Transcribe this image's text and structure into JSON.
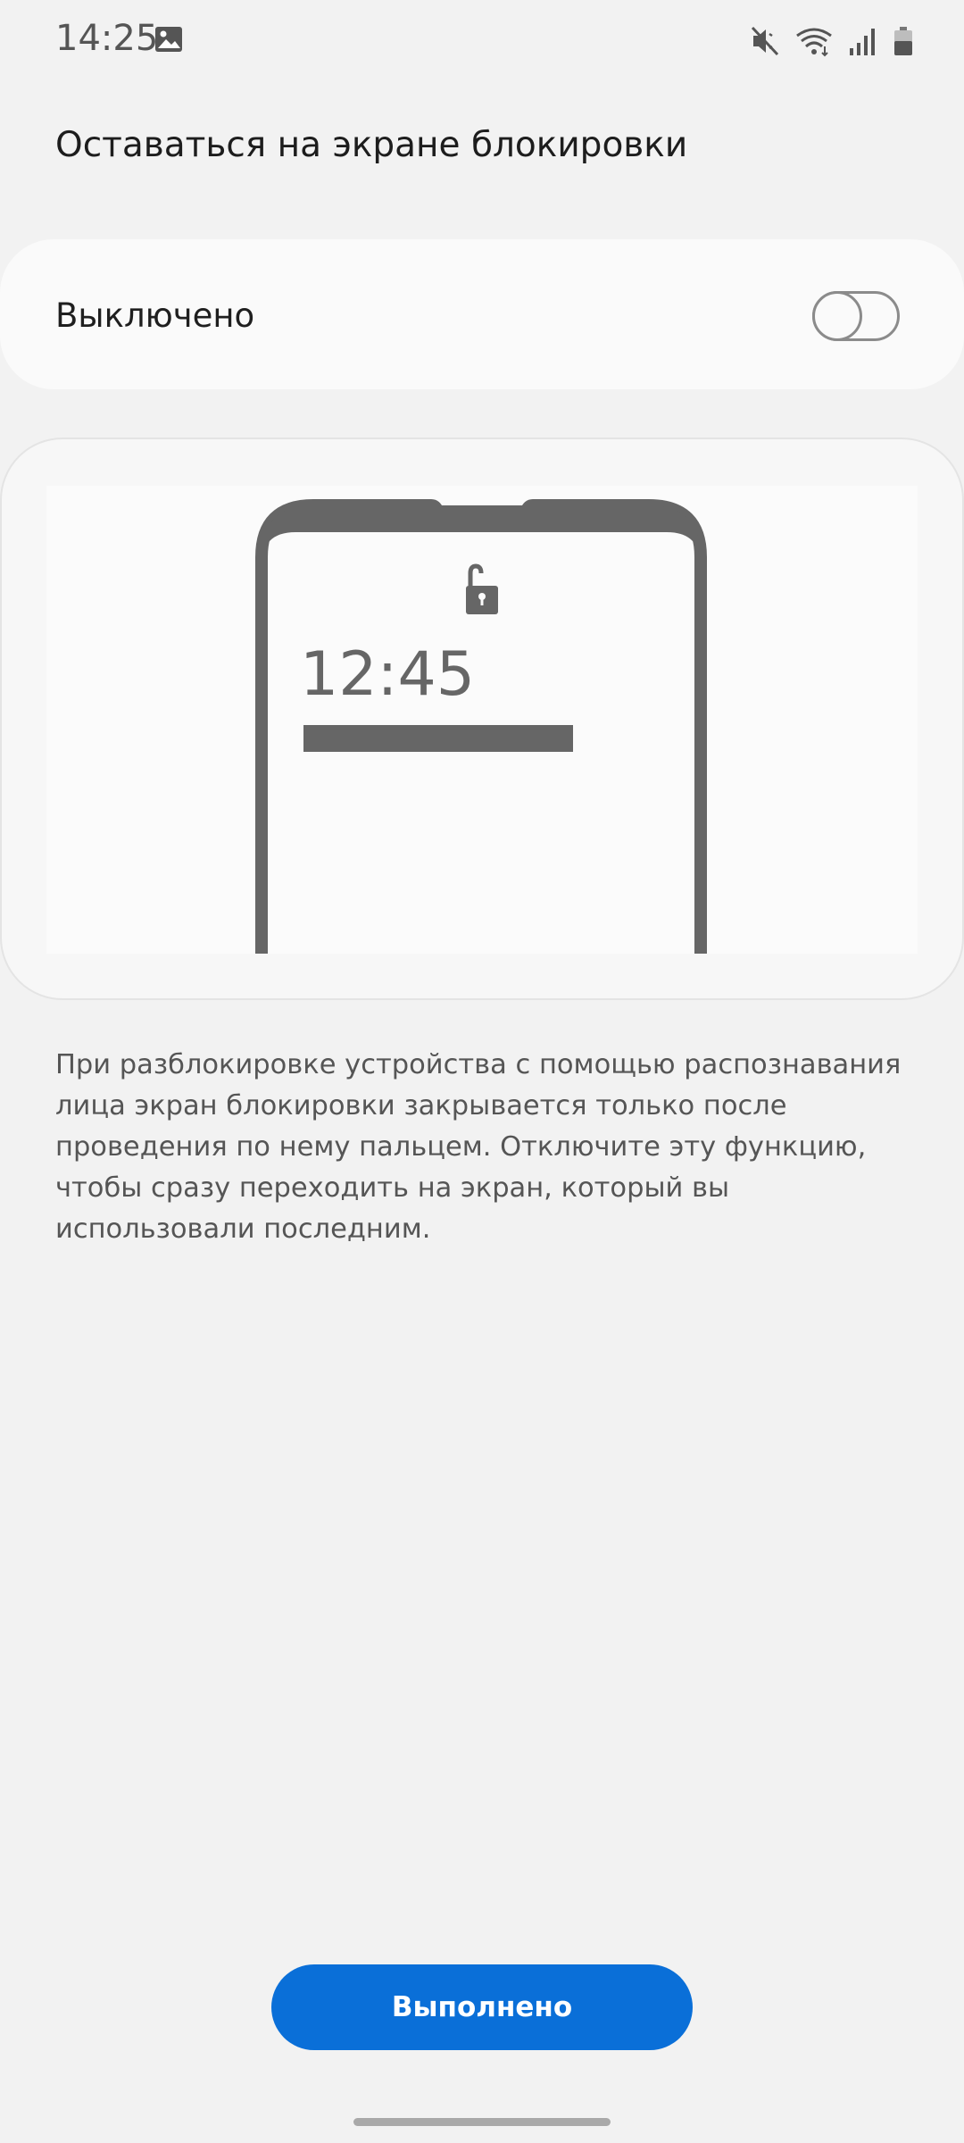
{
  "status_bar": {
    "time": "14:25",
    "icons": [
      "gallery-icon",
      "mute-icon",
      "wifi-icon",
      "signal-icon",
      "battery-icon"
    ]
  },
  "header": {
    "title": "Оставаться на экране блокировки"
  },
  "toggle": {
    "label": "Выключено",
    "state": "off"
  },
  "illustration": {
    "clock": "12:45",
    "icons": [
      "phone-outline",
      "unlocked-padlock-icon"
    ]
  },
  "description": "При разблокировке устройства с помощью распознавания лица экран блокировки закрывается только после проведения по нему пальцем. Отключите эту функцию, чтобы сразу переходить на экран, который вы использовали последним.",
  "footer": {
    "done_label": "Выполнено"
  },
  "colors": {
    "background": "#f2f2f2",
    "card": "#fafafa",
    "accent": "#0a6fd8",
    "illustration_gray": "#666666"
  }
}
